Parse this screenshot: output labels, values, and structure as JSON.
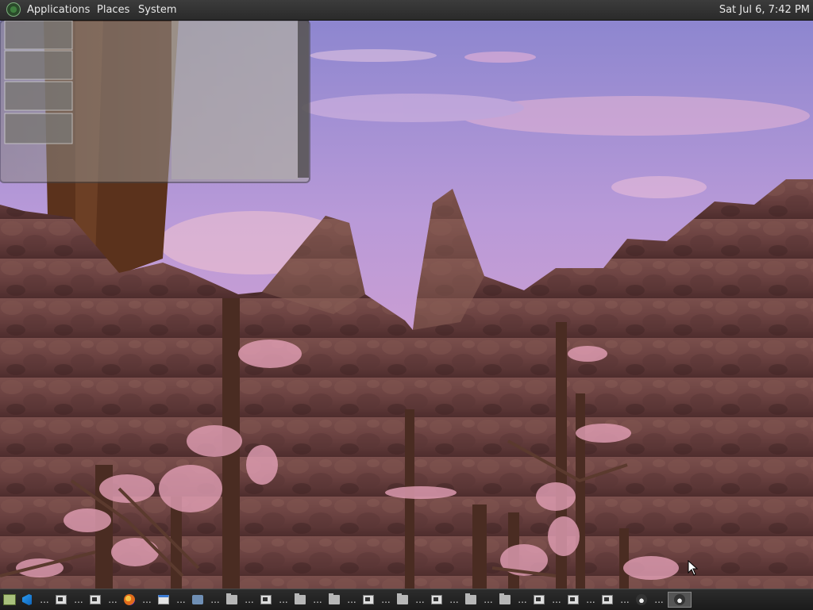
{
  "top_panel": {
    "menus": [
      "Applications",
      "Places",
      "System"
    ],
    "clock": "Sat Jul  6,  7:42 PM"
  },
  "scene": {
    "sky_colors": [
      "#9f8fd0",
      "#c79ed6",
      "#d79cc9"
    ],
    "rock_color": "#6e4644",
    "blossom_color": "#e3a0b6"
  },
  "taskbar": {
    "items": [
      {
        "icon": "file-manager-icon",
        "label": ""
      },
      {
        "icon": "vscode-icon",
        "label": "..."
      },
      {
        "icon": "terminal-icon",
        "label": "..."
      },
      {
        "icon": "terminal-icon",
        "label": "..."
      },
      {
        "icon": "firefox-icon",
        "label": "..."
      },
      {
        "icon": "window-icon",
        "label": "..."
      },
      {
        "icon": "network-icon",
        "label": "..."
      },
      {
        "icon": "folder-icon",
        "label": "..."
      },
      {
        "icon": "terminal-icon",
        "label": "..."
      },
      {
        "icon": "folder-icon",
        "label": "..."
      },
      {
        "icon": "folder-icon",
        "label": "..."
      },
      {
        "icon": "terminal-icon",
        "label": "..."
      },
      {
        "icon": "folder-icon",
        "label": "..."
      },
      {
        "icon": "terminal-icon",
        "label": "..."
      },
      {
        "icon": "folder-icon",
        "label": "..."
      },
      {
        "icon": "folder-icon",
        "label": "..."
      },
      {
        "icon": "terminal-icon",
        "label": "..."
      },
      {
        "icon": "terminal-icon",
        "label": "..."
      },
      {
        "icon": "terminal-icon",
        "label": "..."
      },
      {
        "icon": "monkey-icon",
        "label": "..."
      },
      {
        "icon": "monkey-icon",
        "label": "",
        "active": true
      }
    ]
  }
}
